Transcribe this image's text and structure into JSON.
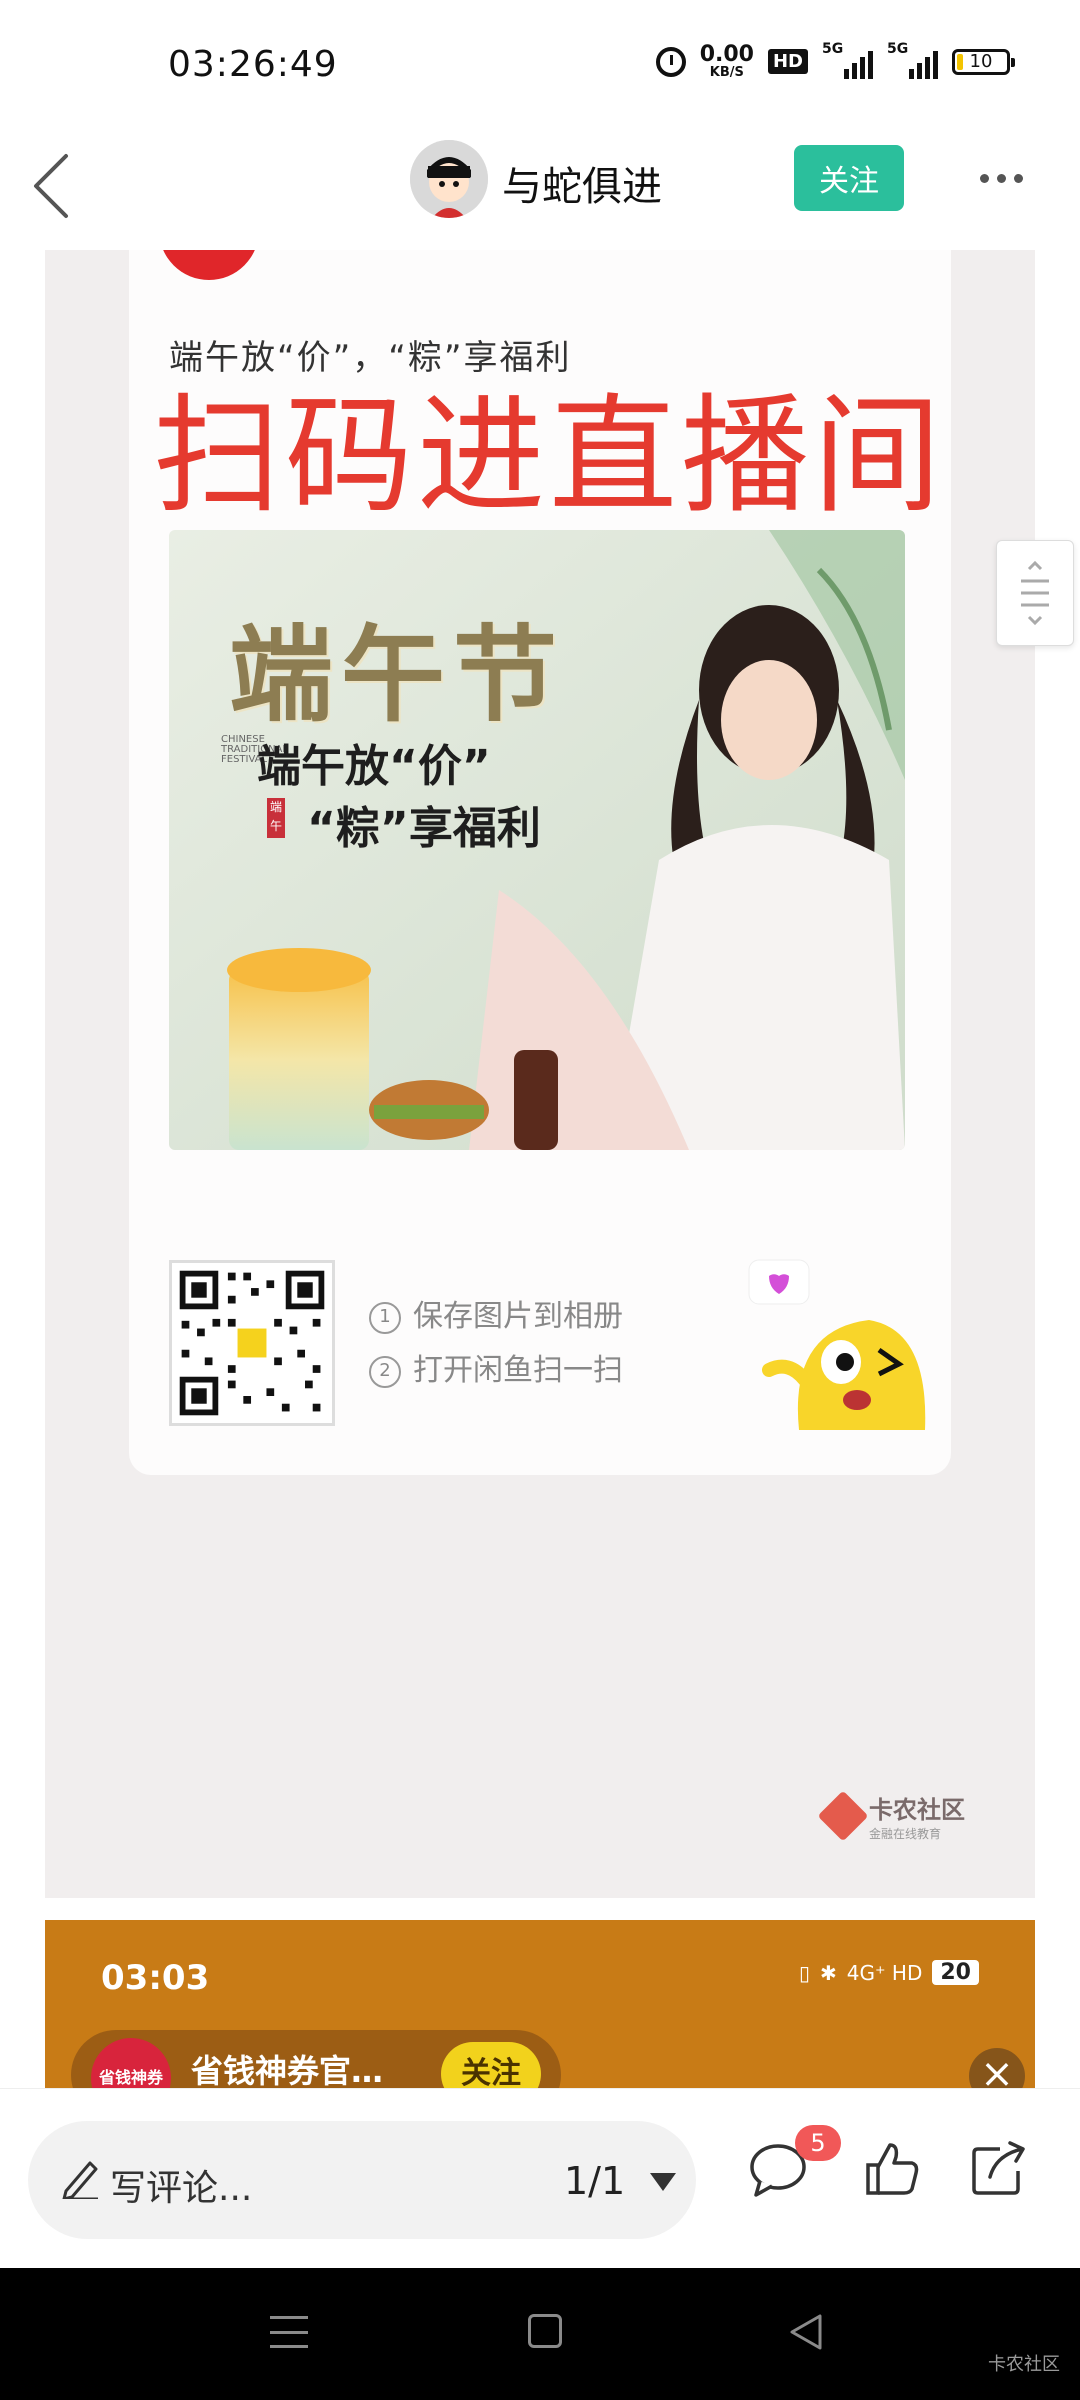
{
  "status_bar": {
    "time": "03:26:49",
    "net_speed_value": "0.00",
    "net_speed_unit": "KB/S",
    "hd_label": "HD",
    "signal1_label": "5G",
    "signal2_label": "5G",
    "battery": "10"
  },
  "nav": {
    "username": "与蛇俱进",
    "follow_label": "关注"
  },
  "poster": {
    "subtitle": "端午放“价”，“粽”享福利",
    "overlay_text": "扫码进直播间",
    "photo_title": "端午节",
    "photo_line1": "端午放“价”",
    "photo_line2": "“粽”享福利",
    "photo_vertical_text": "CHINESE TRADITIONAL FESTIVAL",
    "stamp_text": "端午",
    "step1": "保存图片到相册",
    "step2": "打开闲鱼扫一扫",
    "step1_num": "1",
    "step2_num": "2",
    "watermark_title": "卡农社区",
    "watermark_sub": "金融在线教育"
  },
  "preview": {
    "time": "03:03",
    "network": "4G⁺ HD",
    "battery": "20",
    "logo_text": "省钱神券",
    "name": "省钱神券官…",
    "follow_label": "关注",
    "close_symbol": "×"
  },
  "action_bar": {
    "comment_placeholder": "写评论...",
    "page_indicator": "1/1",
    "comment_badge": "5"
  },
  "system_nav": {
    "watermark": "卡农社区"
  },
  "colors": {
    "follow_green": "#2bbf9c",
    "overlay_red": "#e53a2f",
    "badge_red": "#f15858",
    "preview_orange": "#c87b16"
  }
}
